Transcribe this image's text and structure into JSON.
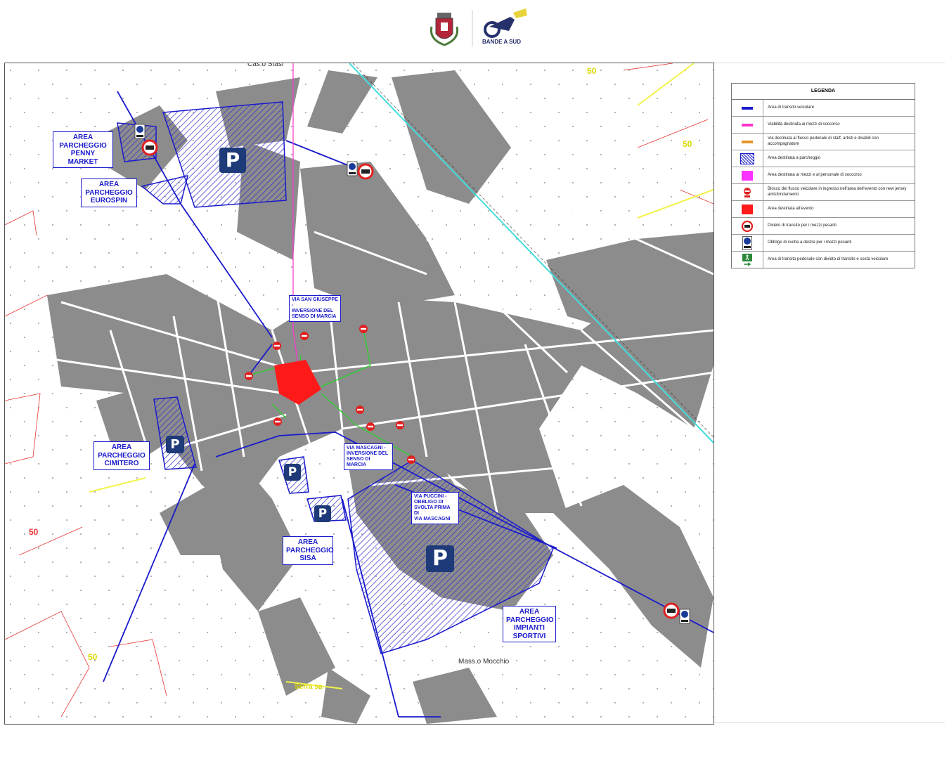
{
  "header": {
    "brand_name": "BANDE A SUD"
  },
  "map": {
    "parking_areas": [
      {
        "key": "penny",
        "label": "AREA\nPARCHEGGIO\nPENNY MARKET"
      },
      {
        "key": "eurospin",
        "label": "AREA\nPARCHEGGIO\nEUROSPIN"
      },
      {
        "key": "cimitero",
        "label": "AREA\nPARCHEGGIO\nCIMITERO"
      },
      {
        "key": "sisa",
        "label": "AREA\nPARCHEGGIO\nSISA"
      },
      {
        "key": "impianti",
        "label": "AREA\nPARCHEGGIO\nIMPIANTI\nSPORTIVI"
      }
    ],
    "street_notes": [
      {
        "key": "san-giuseppe",
        "label": "VIA SAN GIUSEPPE -\nINVERSIONE DEL\nSENSO DI MARCIA"
      },
      {
        "key": "mascagni",
        "label": "VIA MASCAGNI -\nINVERSIONE DEL\nSENSO DI MARCIA"
      },
      {
        "key": "puccini",
        "label": "VIA PUCCINI -\nOBBLIGO DI\nSVOLTA PRIMA DI\nVIA MASCAGNI"
      }
    ],
    "parking_symbol": "P",
    "place_names": {
      "masseria": "Mass.o Mocchio",
      "casa": "Cas.o Stasi",
      "contrada": "Serra sa"
    },
    "contour_labels": [
      "50",
      "50",
      "50",
      "50"
    ],
    "colors": {
      "vehicle_route": "#1a1acc",
      "emergency": "#ff33cc",
      "pedestrian": "#e69526",
      "event_area": "#ff1a1a",
      "building": "#8c8c8c",
      "rail": "#44dddd"
    }
  },
  "legend": {
    "title": "LEGENDA",
    "items": [
      {
        "icon": "blue-line-icon",
        "text": "Area di transito veicolare"
      },
      {
        "icon": "magenta-line-icon",
        "text": "Viabilità destinata ai mezzi di soccorso"
      },
      {
        "icon": "orange-line-icon",
        "text": "Via destinata al flusso pedonale di staff, artisti e disabili con accompagnatore"
      },
      {
        "icon": "parking-hatch-icon",
        "text": "Area destinata a parcheggio"
      },
      {
        "icon": "magenta-area-icon",
        "text": "Area destinata ai mezzi e al personale di soccorso"
      },
      {
        "icon": "no-entry-barrier-icon",
        "text": "Blocco del flusso veicolare in ingresso nell'area dell'evento con new jersey antisfondamento"
      },
      {
        "icon": "event-area-icon",
        "text": "Area destinata all'evento"
      },
      {
        "icon": "no-trucks-icon",
        "text": "Divieto di transito per i mezzi pesanti"
      },
      {
        "icon": "turn-right-trucks-icon",
        "text": "Obbligo di svolta a destra per i mezzi pesanti"
      },
      {
        "icon": "pedestrian-exit-icon",
        "text": "Area di transito pedonale con divieto di transito e sosta veicolare"
      }
    ]
  }
}
